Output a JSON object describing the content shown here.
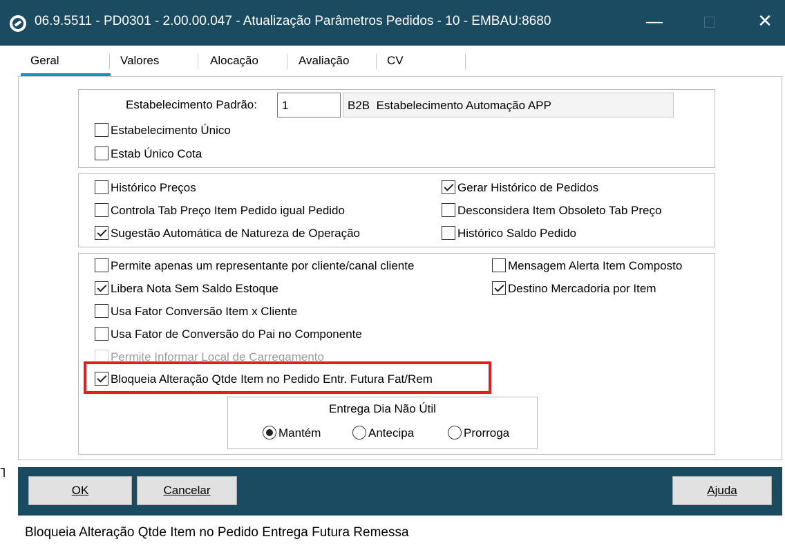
{
  "window": {
    "title": "06.9.5511 - PD0301 - 2.00.00.047 - Atualização Parâmetros Pedidos - 10 - EMBAU:8680",
    "minimize_glyph": "—",
    "close_glyph": "✕"
  },
  "tabs": [
    {
      "label": "Geral",
      "active": true
    },
    {
      "label": "Valores",
      "active": false
    },
    {
      "label": "Alocação",
      "active": false
    },
    {
      "label": "Avaliação",
      "active": false
    },
    {
      "label": "CV",
      "active": false
    }
  ],
  "establishment": {
    "label": "Estabelecimento Padrão:",
    "value": "1",
    "description": "B2B  Estabelecimento Automação APP",
    "unico": {
      "label": "Estabelecimento Único",
      "checked": false
    },
    "unico_cota": {
      "label": "Estab Único Cota",
      "checked": false
    }
  },
  "history": {
    "historico_precos": {
      "label": "Histórico Preços",
      "checked": false
    },
    "controla_tab": {
      "label": "Controla Tab Preço Item Pedido igual Pedido",
      "checked": false
    },
    "sugestao": {
      "label": "Sugestão Automática de Natureza de Operação",
      "checked": true
    },
    "gerar_historico": {
      "label": "Gerar Histórico de Pedidos",
      "checked": true
    },
    "desconsidera": {
      "label": "Desconsidera Item Obsoleto Tab Preço",
      "checked": false
    },
    "historico_saldo": {
      "label": "Histórico Saldo Pedido",
      "checked": false
    }
  },
  "options": {
    "permite_representante": {
      "label": "Permite apenas um representante por cliente/canal cliente",
      "checked": false
    },
    "libera_nota": {
      "label": "Libera Nota Sem Saldo Estoque",
      "checked": true
    },
    "usa_fator": {
      "label": "Usa Fator Conversão Item x Cliente",
      "checked": false
    },
    "usa_fator_pai": {
      "label": "Usa Fator de Conversão do Pai no Componente",
      "checked": false
    },
    "permite_local": {
      "label": "Permite Informar Local de Carregamento",
      "checked": false,
      "disabled": true
    },
    "bloqueia_alteracao": {
      "label": "Bloqueia Alteração Qtde Item no Pedido Entr. Futura Fat/Rem",
      "checked": true
    },
    "mensagem_alerta": {
      "label": "Mensagem Alerta Item Composto",
      "checked": false
    },
    "destino_mercadoria": {
      "label": "Destino Mercadoria por Item",
      "checked": true
    }
  },
  "entrega": {
    "title": "Entrega Dia Não Útil",
    "options": [
      {
        "label": "Mantém",
        "selected": true
      },
      {
        "label": "Antecipa",
        "selected": false
      },
      {
        "label": "Prorroga",
        "selected": false
      }
    ]
  },
  "buttons": {
    "ok": "OK",
    "cancel": "Cancelar",
    "help": "Ajuda"
  },
  "status": {
    "text": "Bloqueia Alteração Qtde Item no Pedido Entrega Futura Remessa"
  },
  "colors": {
    "titlebar": "#1b4b61",
    "active_tab": "#1e90c8",
    "highlight": "#e02020"
  }
}
